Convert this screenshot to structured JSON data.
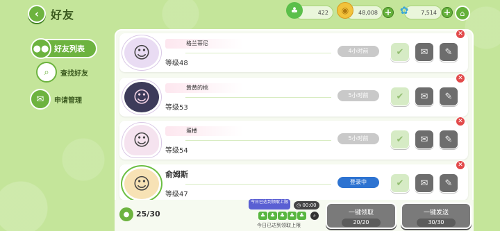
{
  "header": {
    "title": "好友",
    "back_icon": "arrow-left-icon",
    "home_icon": "home-icon"
  },
  "resources": [
    {
      "icon": "clover-currency-icon",
      "value": "422"
    },
    {
      "icon": "gold-coin-icon",
      "value": "48,008"
    },
    {
      "icon": "butterfly-icon",
      "value": "7,514"
    }
  ],
  "nav": {
    "items": [
      {
        "label": "好友列表",
        "icon": "friends-icon",
        "active": true
      },
      {
        "label": "查找好友",
        "icon": "search-icon",
        "active": false
      },
      {
        "label": "申请管理",
        "icon": "application-icon",
        "active": false
      }
    ]
  },
  "friends": [
    {
      "name": "格兰蒂尼",
      "level": "等级48",
      "status": "4小时前",
      "online": false
    },
    {
      "name": "黄黄的桃",
      "level": "等级53",
      "status": "5小时前",
      "online": false
    },
    {
      "name": "蛋楼",
      "level": "等级54",
      "status": "5小时前",
      "online": false
    },
    {
      "name": "俞姆斯",
      "level": "等级47",
      "status": "登录中",
      "online": true
    }
  ],
  "footer": {
    "friend_count": "25/30",
    "limit_tip": "今日已达到领取上限",
    "timer": "00:00",
    "limit_text": "今日已达到领取上限",
    "collect_label": "一键领取",
    "collect_count": "20/20",
    "send_label": "一键发送",
    "send_count": "30/30"
  },
  "colors": {
    "background": "#c4e59a",
    "accent_green": "#6db33f",
    "online_blue": "#2d73d1",
    "delete_red": "#e24a4a"
  }
}
